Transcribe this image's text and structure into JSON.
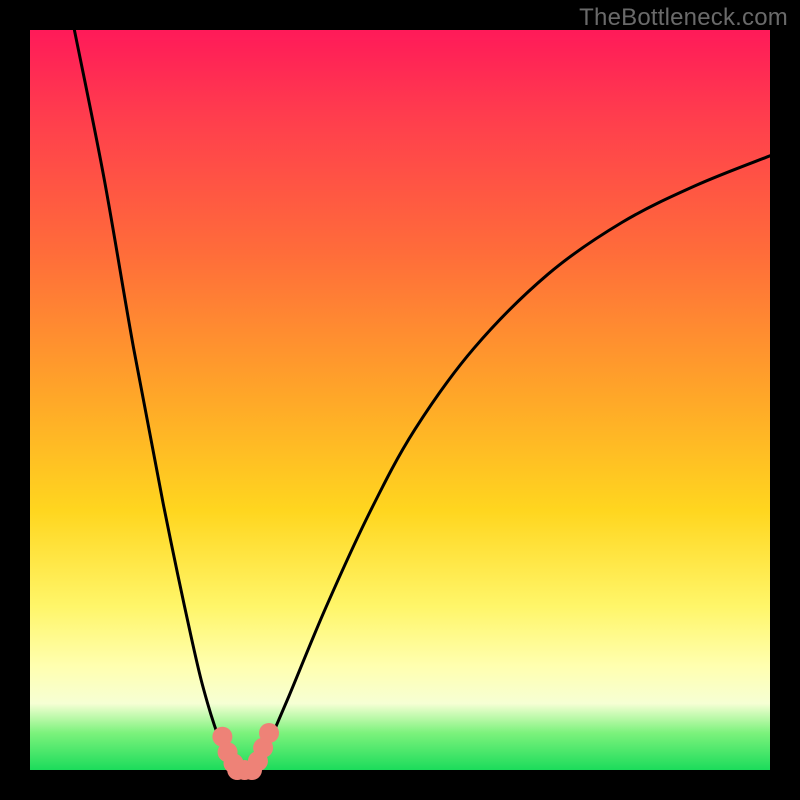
{
  "watermark": "TheBottleneck.com",
  "chart_data": {
    "type": "line",
    "title": "",
    "xlabel": "",
    "ylabel": "",
    "xlim": [
      0,
      100
    ],
    "ylim": [
      0,
      100
    ],
    "series": [
      {
        "name": "bottleneck-curve",
        "x": [
          6,
          10,
          14,
          18,
          22,
          24,
          26,
          27,
          28,
          29,
          30,
          31,
          32,
          35,
          40,
          46,
          52,
          60,
          70,
          80,
          90,
          100
        ],
        "values": [
          100,
          80,
          57,
          36,
          17,
          9,
          3,
          1,
          0,
          0,
          0,
          1,
          3,
          10,
          22,
          35,
          46,
          57,
          67,
          74,
          79,
          83
        ]
      }
    ],
    "markers": {
      "name": "lowest-bottleneck-dots",
      "x": [
        26.0,
        26.7,
        27.5,
        28.0,
        29.0,
        30.0,
        30.8,
        31.5,
        32.3
      ],
      "values": [
        4.5,
        2.4,
        0.9,
        0.0,
        0.0,
        0.0,
        1.2,
        3.0,
        5.0
      ]
    },
    "gradient_stops": [
      {
        "pos": 0,
        "color": "#ff1a59"
      },
      {
        "pos": 50,
        "color": "#ffa828"
      },
      {
        "pos": 78,
        "color": "#fff66a"
      },
      {
        "pos": 100,
        "color": "#1bdc5b"
      }
    ]
  }
}
